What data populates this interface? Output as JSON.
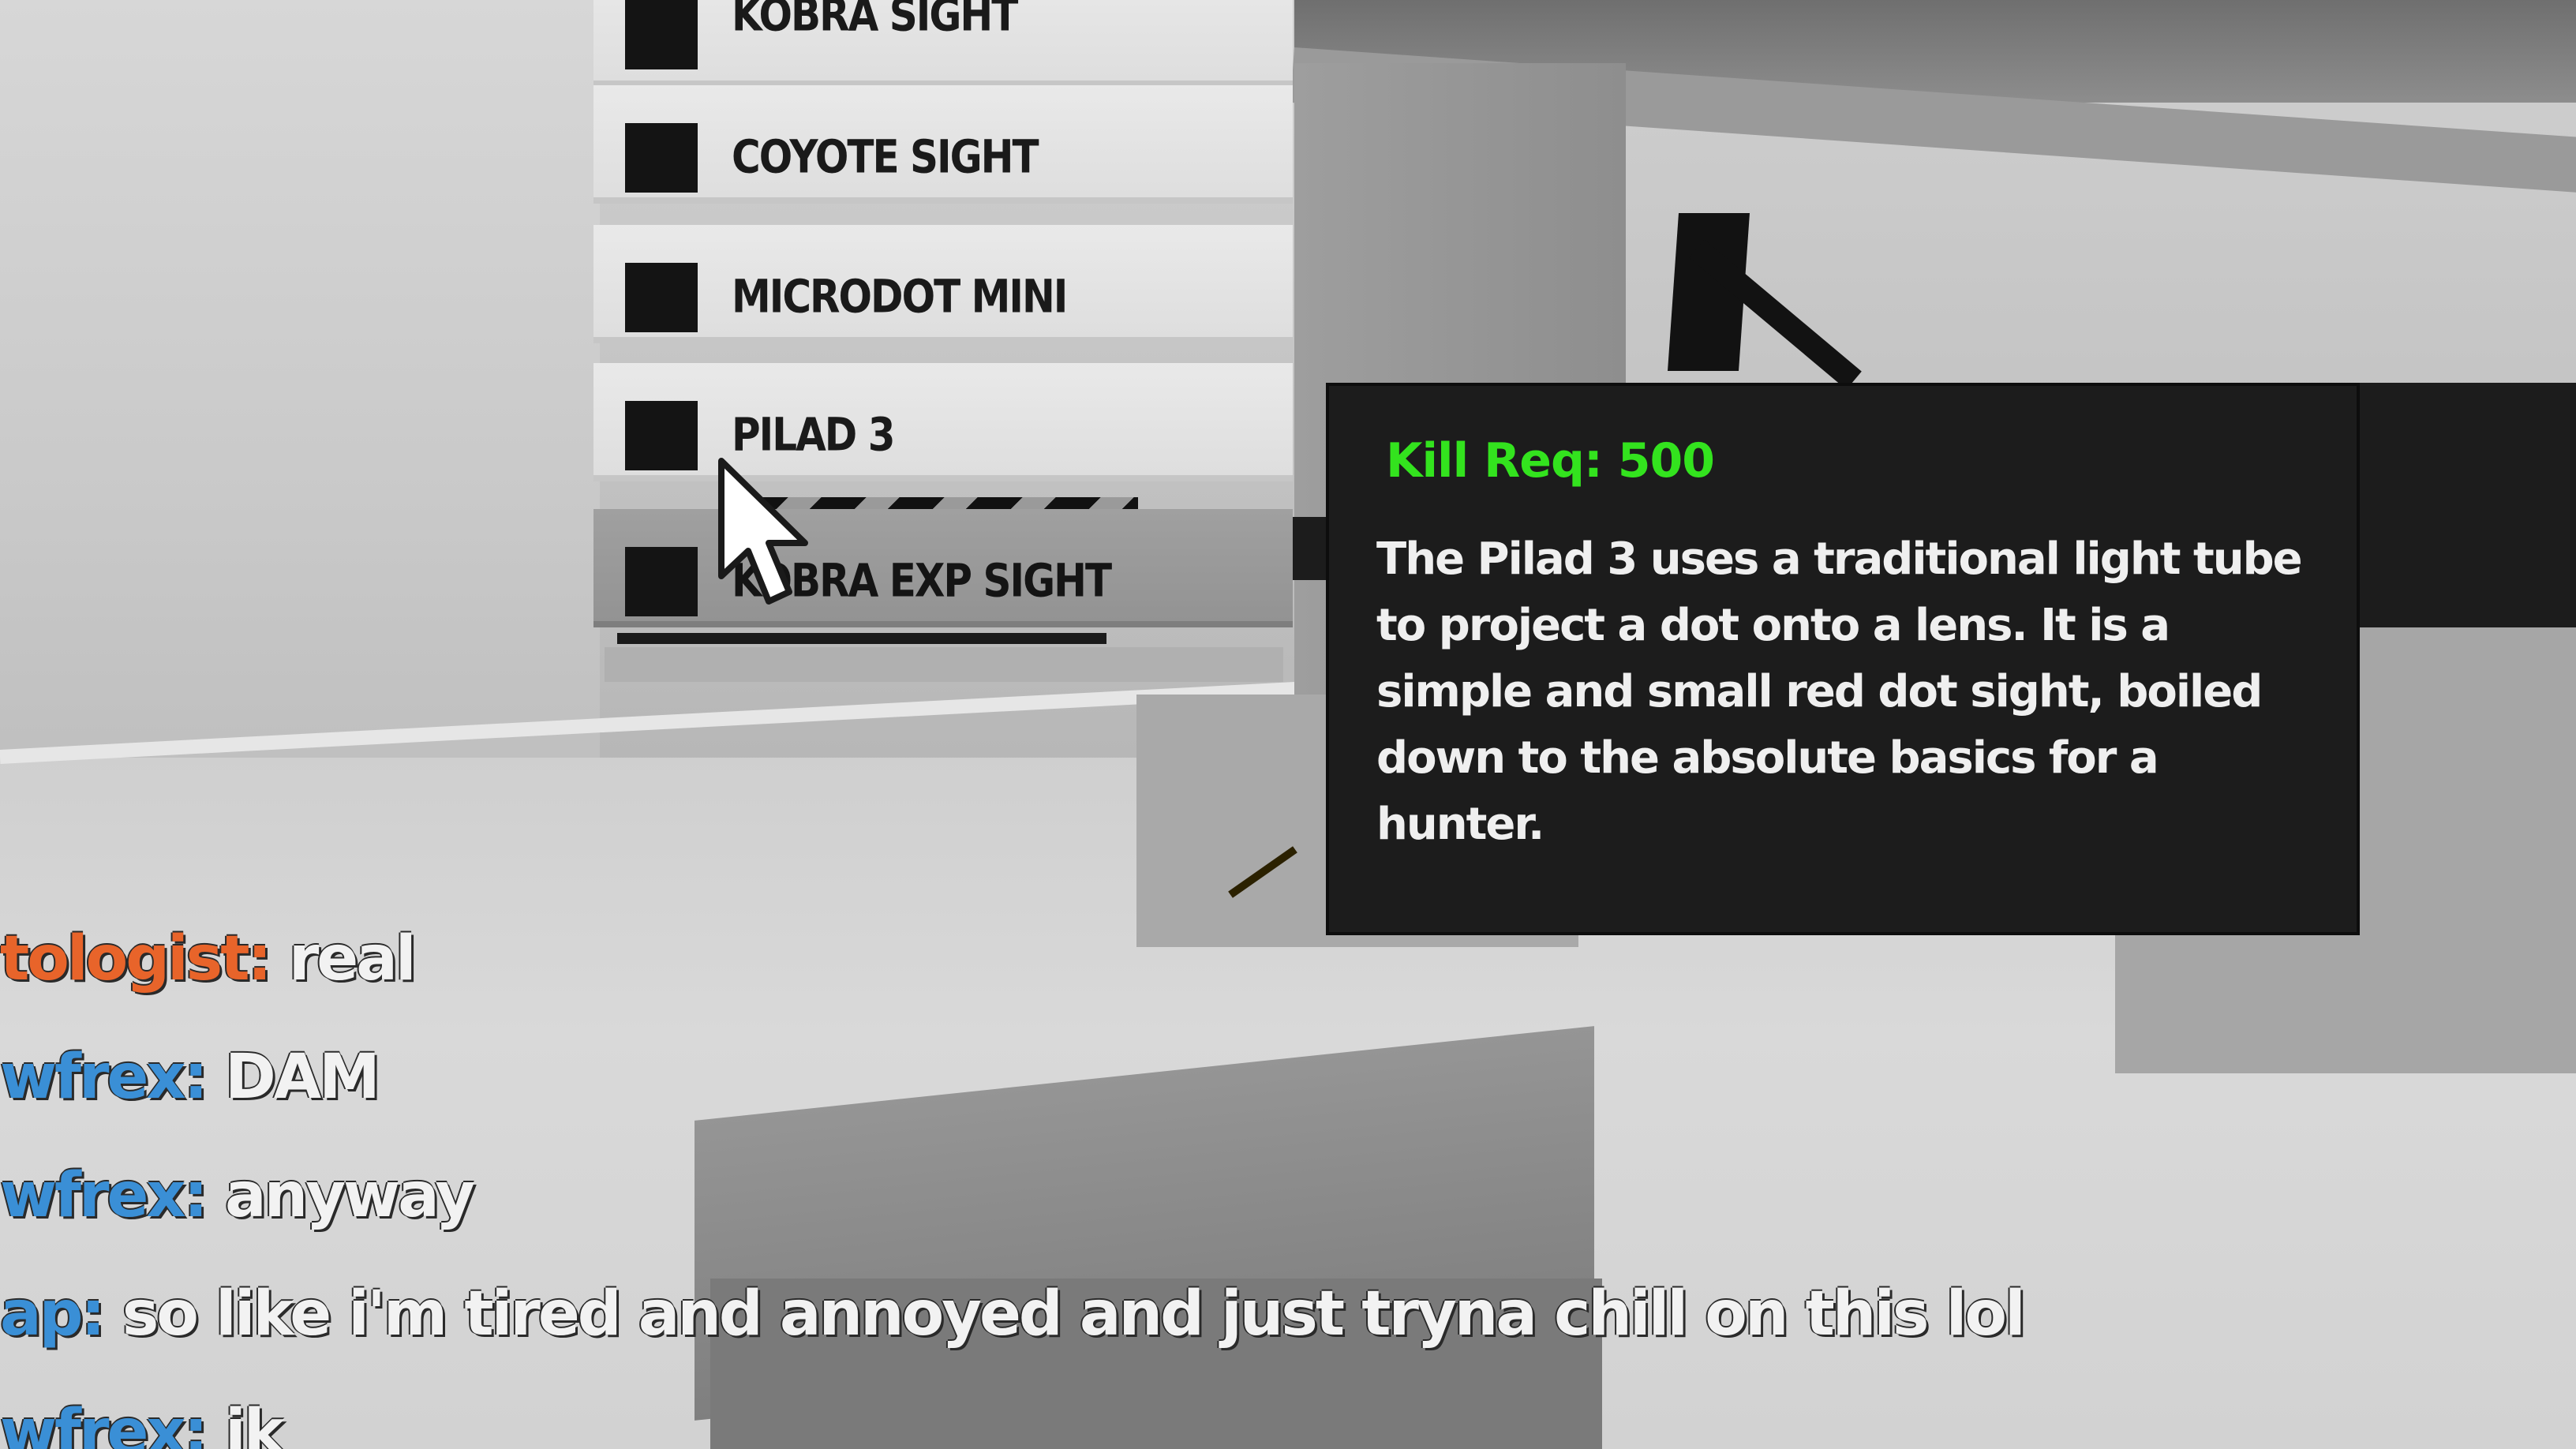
{
  "attachments": {
    "items": [
      {
        "label": "KOBRA SIGHT",
        "selected": false
      },
      {
        "label": "COYOTE SIGHT",
        "selected": false
      },
      {
        "label": "MICRODOT MINI",
        "selected": false
      },
      {
        "label": "PILAD 3",
        "selected": false
      },
      {
        "label": "KOBRA EXP SIGHT",
        "selected": true
      }
    ]
  },
  "tooltip": {
    "kill_req": "Kill Req: 500",
    "description": "The Pilad 3 uses a traditional light tube to project a dot onto a lens. It is a simple and small red dot sight, boiled down to the absolute basics for a hunter.",
    "kill_req_color": "#33e31e"
  },
  "chat": {
    "messages": [
      {
        "name": "tologist:",
        "text": "real",
        "name_color": "#e8642a"
      },
      {
        "name": "wfrex:",
        "text": "DAM",
        "name_color": "#3a8fd6"
      },
      {
        "name": "wfrex:",
        "text": "anyway",
        "name_color": "#3a8fd6"
      },
      {
        "name": "ap:",
        "text": "so like i'm tired and annoyed and just tryna chill on this lol",
        "name_color": "#3a8fd6"
      },
      {
        "name": "wfrex:",
        "text": "ik",
        "name_color": "#3a8fd6"
      }
    ]
  },
  "icons": {
    "cursor": "mouse-pointer-icon"
  }
}
